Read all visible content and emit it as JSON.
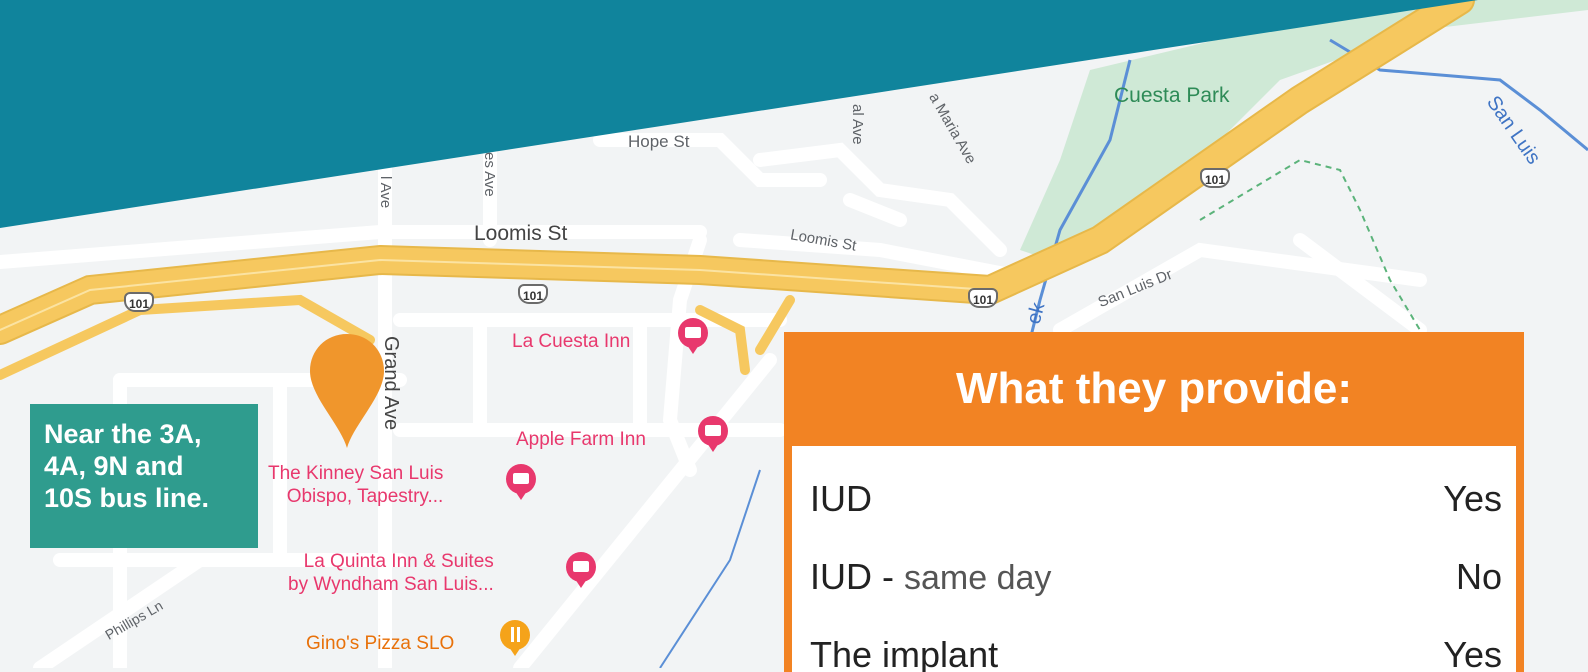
{
  "map": {
    "street_labels": {
      "hope": "Hope St",
      "loomis_main": "Loomis St",
      "loomis_small": "Loomis St",
      "grand": "Grand Ave",
      "san_luis_dr": "San Luis Dr",
      "phillips": "Phillips Ln",
      "santa_maria": "a Maria Ave",
      "al_ave": "al Ave",
      "es_ave": "es Ave",
      "l_ave": "l Ave",
      "creek": "ek",
      "san_luis_creek": "San Luis"
    },
    "park": "Cuesta Park",
    "highway_shield": "101",
    "pois": {
      "la_cuesta": "La Cuesta Inn",
      "apple_farm": "Apple Farm Inn",
      "kinney_line1": "The Kinney San Luis",
      "kinney_line2": "Obispo, Tapestry...",
      "la_quinta_line1": "La Quinta Inn & Suites",
      "la_quinta_line2": "by Wyndham San Luis...",
      "ginos": "Gino's Pizza SLO"
    },
    "colors": {
      "background": "#f2f4f5",
      "highway": "#f6c85f",
      "park": "#cfe9d6",
      "water": "#5b8fd6",
      "poi_lodging": "#e8386d",
      "poi_food": "#f5a31a"
    }
  },
  "banner": {
    "color": "#10849c"
  },
  "callout": {
    "lines": [
      "Near the 3A,",
      "4A, 9N and",
      "10S  bus line."
    ],
    "color": "#2f9c8e"
  },
  "location_pin": {
    "color": "#f0962c"
  },
  "provide_panel": {
    "title": "What they provide:",
    "accent": "#f28323",
    "rows": [
      {
        "label": "IUD",
        "qualifier": "",
        "value": "Yes"
      },
      {
        "label": "IUD - ",
        "qualifier": "same day",
        "value": "No"
      },
      {
        "label": "The implant",
        "qualifier": "",
        "value": "Yes"
      }
    ]
  }
}
